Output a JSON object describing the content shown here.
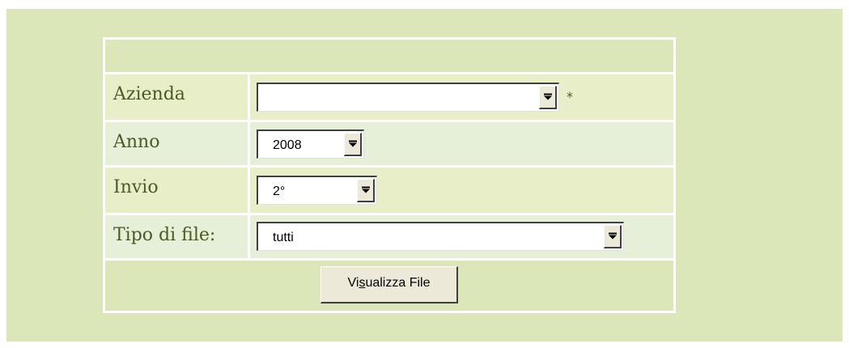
{
  "form": {
    "rows": [
      {
        "label": "Azienda",
        "value": "",
        "required_mark": "*"
      },
      {
        "label": "Anno",
        "value": "2008"
      },
      {
        "label": "Invio",
        "value": "2°"
      },
      {
        "label": "Tipo di file:",
        "value": "tutti"
      }
    ],
    "button": {
      "label_pre": "Vi",
      "label_mnemonic": "s",
      "label_post": "ualizza File"
    }
  },
  "colors": {
    "panel": "#dbe6b9",
    "row_alt_a": "#e8eec8",
    "row_alt_b": "#e6efd7",
    "label_text": "#4d5a26"
  },
  "icons": {
    "dropdown": "chevron-down-icon"
  }
}
